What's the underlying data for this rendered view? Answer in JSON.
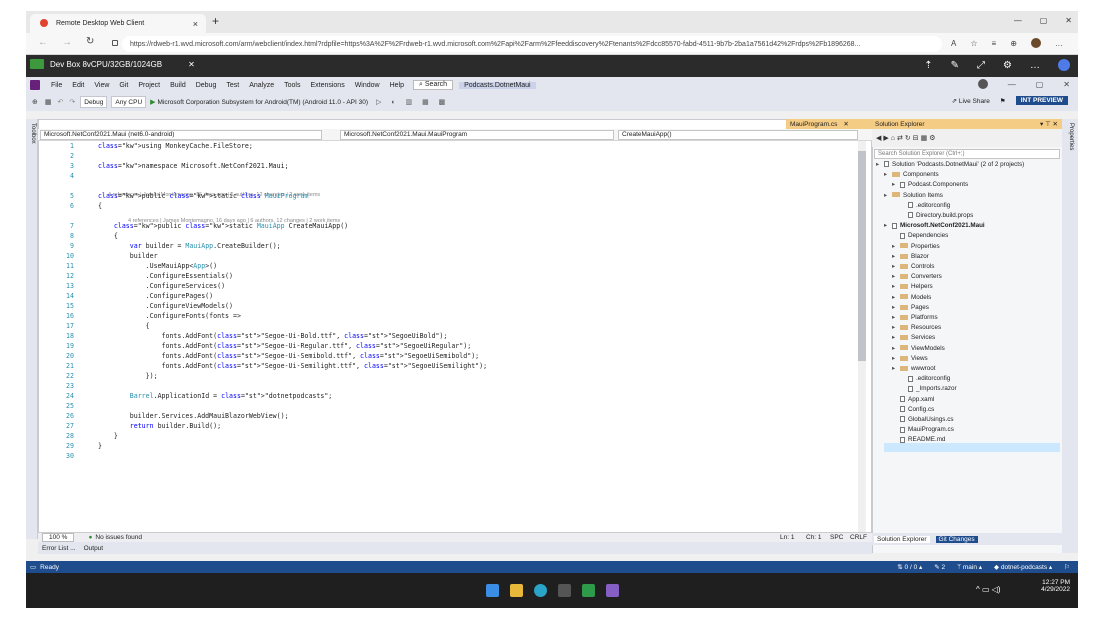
{
  "browser": {
    "tab_title": "Remote Desktop Web Client",
    "tab_close": "×",
    "new_tab": "+",
    "url": "https://rdweb-r1.wvd.microsoft.com/arm/webclient/index.html?rdpfile=https%3A%2F%2Frdweb-r1.wvd.microsoft.com%2Fapi%2Farm%2Ffeeddiscovery%2Ftenants%2Fdcc85570-fabd-4511-9b7b-2ba1a7561d42%2Frdps%2Fb1896268...",
    "win_controls": [
      "—",
      "▢",
      "✕"
    ]
  },
  "remote": {
    "title": "Dev Box 8vCPU/32GB/1024GB",
    "close": "✕"
  },
  "vs": {
    "menu": [
      "File",
      "Edit",
      "View",
      "Git",
      "Project",
      "Build",
      "Debug",
      "Test",
      "Analyze",
      "Tools",
      "Extensions",
      "Window",
      "Help"
    ],
    "search": "Search",
    "solution_name": "Podcasts.DotnetMaui",
    "config": "Debug",
    "platform": "Any CPU",
    "run_target": "Microsoft Corporation Subsystem for Android(TM) (Android 11.0 - API 30)",
    "live_share": "Live Share",
    "int_preview": "INT PREVIEW",
    "toolbox": "Toolbox",
    "properties": "Properties",
    "doc_tab": "MauiProgram.cs",
    "nav": {
      "project": "Microsoft.NetConf2021.Maui (net6.0-android)",
      "class": "Microsoft.NetConf2021.Maui.MauiProgram",
      "member": "CreateMauiApp()"
    },
    "code": [
      {
        "n": "1",
        "t": "using MonkeyCache.FileStore;"
      },
      {
        "n": "2",
        "t": ""
      },
      {
        "n": "3",
        "t": "namespace Microsoft.NetConf2021.Maui;"
      },
      {
        "n": "4",
        "t": ""
      },
      {
        "n": "5",
        "t": "public static class MauiProgram"
      },
      {
        "n": "6",
        "t": "{"
      },
      {
        "n": "7",
        "t": "    public static MauiApp CreateMauiApp()"
      },
      {
        "n": "8",
        "t": "    {"
      },
      {
        "n": "9",
        "t": "        var builder = MauiApp.CreateBuilder();"
      },
      {
        "n": "10",
        "t": "        builder"
      },
      {
        "n": "11",
        "t": "            .UseMauiApp<App>()"
      },
      {
        "n": "12",
        "t": "            .ConfigureEssentials()"
      },
      {
        "n": "13",
        "t": "            .ConfigureServices()"
      },
      {
        "n": "14",
        "t": "            .ConfigurePages()"
      },
      {
        "n": "15",
        "t": "            .ConfigureViewModels()"
      },
      {
        "n": "16",
        "t": "            .ConfigureFonts(fonts =>"
      },
      {
        "n": "17",
        "t": "            {"
      },
      {
        "n": "18",
        "t": "                fonts.AddFont(\"Segoe-Ui-Bold.ttf\", \"SegoeUiBold\");"
      },
      {
        "n": "19",
        "t": "                fonts.AddFont(\"Segoe-Ui-Regular.ttf\", \"SegoeUiRegular\");"
      },
      {
        "n": "20",
        "t": "                fonts.AddFont(\"Segoe-Ui-Semibold.ttf\", \"SegoeUiSemibold\");"
      },
      {
        "n": "21",
        "t": "                fonts.AddFont(\"Segoe-Ui-Semilight.ttf\", \"SegoeUiSemilight\");"
      },
      {
        "n": "22",
        "t": "            });"
      },
      {
        "n": "23",
        "t": ""
      },
      {
        "n": "24",
        "t": "        Barrel.ApplicationId = \"dotnetpodcasts\";"
      },
      {
        "n": "25",
        "t": ""
      },
      {
        "n": "26",
        "t": "        builder.Services.AddMauiBlazorWebView();"
      },
      {
        "n": "27",
        "t": "        return builder.Build();"
      },
      {
        "n": "28",
        "t": "    }"
      },
      {
        "n": "29",
        "t": "}"
      },
      {
        "n": "30",
        "t": ""
      }
    ],
    "codelens_class": "4 references | James Montemagno, 16 days ago | 6 authors, 12 changes | 2 work items",
    "codelens_method": "4 references | James Montemagno, 16 days ago | 6 authors, 12 changes | 2 work items",
    "status_editor": {
      "zoom": "100 %",
      "issues": "No issues found",
      "ln": "Ln: 1",
      "ch": "Ch: 1",
      "spc": "SPC",
      "crlf": "CRLF"
    },
    "bottom_tabs": [
      "Error List ...",
      "Output"
    ],
    "status_bar": {
      "ready": "Ready",
      "counts": "0 / 0 ▴",
      "pencil": "2",
      "branch": "main ▴",
      "repo": "dotnet-podcasts ▴"
    }
  },
  "solution_explorer": {
    "title": "Solution Explorer",
    "search_placeholder": "Search Solution Explorer (Ctrl+;)",
    "items": [
      {
        "label": "Solution 'Podcasts.DotnetMaui' (2 of 2 projects)",
        "kind": "solution",
        "indent": 0
      },
      {
        "label": "Components",
        "kind": "folder",
        "indent": 1
      },
      {
        "label": "Podcast.Components",
        "kind": "project",
        "indent": 2
      },
      {
        "label": "Solution Items",
        "kind": "folder",
        "indent": 1
      },
      {
        "label": ".editorconfig",
        "kind": "file",
        "indent": 3
      },
      {
        "label": "Directory.build.props",
        "kind": "file",
        "indent": 3
      },
      {
        "label": "Microsoft.NetConf2021.Maui",
        "kind": "project",
        "indent": 1
      },
      {
        "label": "Dependencies",
        "kind": "file",
        "indent": 2
      },
      {
        "label": "Properties",
        "kind": "folder",
        "indent": 2
      },
      {
        "label": "Blazor",
        "kind": "folder",
        "indent": 2
      },
      {
        "label": "Controls",
        "kind": "folder",
        "indent": 2
      },
      {
        "label": "Converters",
        "kind": "folder",
        "indent": 2
      },
      {
        "label": "Helpers",
        "kind": "folder",
        "indent": 2
      },
      {
        "label": "Models",
        "kind": "folder",
        "indent": 2
      },
      {
        "label": "Pages",
        "kind": "folder",
        "indent": 2
      },
      {
        "label": "Platforms",
        "kind": "folder",
        "indent": 2
      },
      {
        "label": "Resources",
        "kind": "folder",
        "indent": 2
      },
      {
        "label": "Services",
        "kind": "folder",
        "indent": 2
      },
      {
        "label": "ViewModels",
        "kind": "folder",
        "indent": 2
      },
      {
        "label": "Views",
        "kind": "folder",
        "indent": 2
      },
      {
        "label": "wwwroot",
        "kind": "folder",
        "indent": 2
      },
      {
        "label": ".editorconfig",
        "kind": "file",
        "indent": 3
      },
      {
        "label": "_Imports.razor",
        "kind": "file",
        "indent": 3
      },
      {
        "label": "App.xaml",
        "kind": "file",
        "indent": 2
      },
      {
        "label": "Config.cs",
        "kind": "file",
        "indent": 2
      },
      {
        "label": "GlobalUsings.cs",
        "kind": "file",
        "indent": 2
      },
      {
        "label": "MauiProgram.cs",
        "kind": "file",
        "indent": 2
      },
      {
        "label": "README.md",
        "kind": "file",
        "indent": 2
      }
    ],
    "bottom_tabs": [
      "Solution Explorer",
      "Git Changes"
    ]
  },
  "taskbar": {
    "time": "12:27 PM",
    "date": "4/29/2022"
  },
  "colors": {
    "accent": "#1f4c8c",
    "tab_active": "#f5cc84",
    "keyword": "#0000ff",
    "type": "#2b91af",
    "string": "#a31515"
  }
}
